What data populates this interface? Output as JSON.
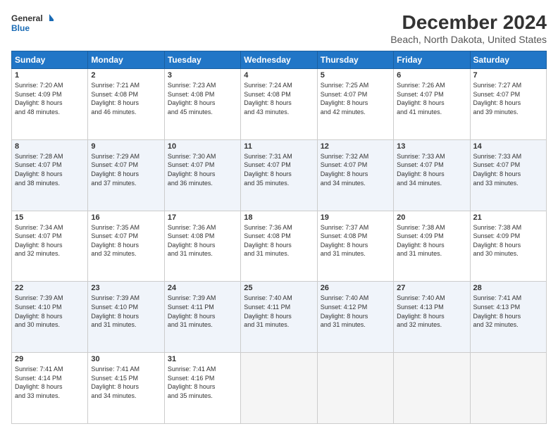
{
  "header": {
    "logo_line1": "General",
    "logo_line2": "Blue",
    "title": "December 2024",
    "subtitle": "Beach, North Dakota, United States"
  },
  "columns": [
    "Sunday",
    "Monday",
    "Tuesday",
    "Wednesday",
    "Thursday",
    "Friday",
    "Saturday"
  ],
  "rows": [
    [
      {
        "date": "1",
        "lines": [
          "Sunrise: 7:20 AM",
          "Sunset: 4:09 PM",
          "Daylight: 8 hours",
          "and 48 minutes."
        ]
      },
      {
        "date": "2",
        "lines": [
          "Sunrise: 7:21 AM",
          "Sunset: 4:08 PM",
          "Daylight: 8 hours",
          "and 46 minutes."
        ]
      },
      {
        "date": "3",
        "lines": [
          "Sunrise: 7:23 AM",
          "Sunset: 4:08 PM",
          "Daylight: 8 hours",
          "and 45 minutes."
        ]
      },
      {
        "date": "4",
        "lines": [
          "Sunrise: 7:24 AM",
          "Sunset: 4:08 PM",
          "Daylight: 8 hours",
          "and 43 minutes."
        ]
      },
      {
        "date": "5",
        "lines": [
          "Sunrise: 7:25 AM",
          "Sunset: 4:07 PM",
          "Daylight: 8 hours",
          "and 42 minutes."
        ]
      },
      {
        "date": "6",
        "lines": [
          "Sunrise: 7:26 AM",
          "Sunset: 4:07 PM",
          "Daylight: 8 hours",
          "and 41 minutes."
        ]
      },
      {
        "date": "7",
        "lines": [
          "Sunrise: 7:27 AM",
          "Sunset: 4:07 PM",
          "Daylight: 8 hours",
          "and 39 minutes."
        ]
      }
    ],
    [
      {
        "date": "8",
        "lines": [
          "Sunrise: 7:28 AM",
          "Sunset: 4:07 PM",
          "Daylight: 8 hours",
          "and 38 minutes."
        ]
      },
      {
        "date": "9",
        "lines": [
          "Sunrise: 7:29 AM",
          "Sunset: 4:07 PM",
          "Daylight: 8 hours",
          "and 37 minutes."
        ]
      },
      {
        "date": "10",
        "lines": [
          "Sunrise: 7:30 AM",
          "Sunset: 4:07 PM",
          "Daylight: 8 hours",
          "and 36 minutes."
        ]
      },
      {
        "date": "11",
        "lines": [
          "Sunrise: 7:31 AM",
          "Sunset: 4:07 PM",
          "Daylight: 8 hours",
          "and 35 minutes."
        ]
      },
      {
        "date": "12",
        "lines": [
          "Sunrise: 7:32 AM",
          "Sunset: 4:07 PM",
          "Daylight: 8 hours",
          "and 34 minutes."
        ]
      },
      {
        "date": "13",
        "lines": [
          "Sunrise: 7:33 AM",
          "Sunset: 4:07 PM",
          "Daylight: 8 hours",
          "and 34 minutes."
        ]
      },
      {
        "date": "14",
        "lines": [
          "Sunrise: 7:33 AM",
          "Sunset: 4:07 PM",
          "Daylight: 8 hours",
          "and 33 minutes."
        ]
      }
    ],
    [
      {
        "date": "15",
        "lines": [
          "Sunrise: 7:34 AM",
          "Sunset: 4:07 PM",
          "Daylight: 8 hours",
          "and 32 minutes."
        ]
      },
      {
        "date": "16",
        "lines": [
          "Sunrise: 7:35 AM",
          "Sunset: 4:07 PM",
          "Daylight: 8 hours",
          "and 32 minutes."
        ]
      },
      {
        "date": "17",
        "lines": [
          "Sunrise: 7:36 AM",
          "Sunset: 4:08 PM",
          "Daylight: 8 hours",
          "and 31 minutes."
        ]
      },
      {
        "date": "18",
        "lines": [
          "Sunrise: 7:36 AM",
          "Sunset: 4:08 PM",
          "Daylight: 8 hours",
          "and 31 minutes."
        ]
      },
      {
        "date": "19",
        "lines": [
          "Sunrise: 7:37 AM",
          "Sunset: 4:08 PM",
          "Daylight: 8 hours",
          "and 31 minutes."
        ]
      },
      {
        "date": "20",
        "lines": [
          "Sunrise: 7:38 AM",
          "Sunset: 4:09 PM",
          "Daylight: 8 hours",
          "and 31 minutes."
        ]
      },
      {
        "date": "21",
        "lines": [
          "Sunrise: 7:38 AM",
          "Sunset: 4:09 PM",
          "Daylight: 8 hours",
          "and 30 minutes."
        ]
      }
    ],
    [
      {
        "date": "22",
        "lines": [
          "Sunrise: 7:39 AM",
          "Sunset: 4:10 PM",
          "Daylight: 8 hours",
          "and 30 minutes."
        ]
      },
      {
        "date": "23",
        "lines": [
          "Sunrise: 7:39 AM",
          "Sunset: 4:10 PM",
          "Daylight: 8 hours",
          "and 31 minutes."
        ]
      },
      {
        "date": "24",
        "lines": [
          "Sunrise: 7:39 AM",
          "Sunset: 4:11 PM",
          "Daylight: 8 hours",
          "and 31 minutes."
        ]
      },
      {
        "date": "25",
        "lines": [
          "Sunrise: 7:40 AM",
          "Sunset: 4:11 PM",
          "Daylight: 8 hours",
          "and 31 minutes."
        ]
      },
      {
        "date": "26",
        "lines": [
          "Sunrise: 7:40 AM",
          "Sunset: 4:12 PM",
          "Daylight: 8 hours",
          "and 31 minutes."
        ]
      },
      {
        "date": "27",
        "lines": [
          "Sunrise: 7:40 AM",
          "Sunset: 4:13 PM",
          "Daylight: 8 hours",
          "and 32 minutes."
        ]
      },
      {
        "date": "28",
        "lines": [
          "Sunrise: 7:41 AM",
          "Sunset: 4:13 PM",
          "Daylight: 8 hours",
          "and 32 minutes."
        ]
      }
    ],
    [
      {
        "date": "29",
        "lines": [
          "Sunrise: 7:41 AM",
          "Sunset: 4:14 PM",
          "Daylight: 8 hours",
          "and 33 minutes."
        ]
      },
      {
        "date": "30",
        "lines": [
          "Sunrise: 7:41 AM",
          "Sunset: 4:15 PM",
          "Daylight: 8 hours",
          "and 34 minutes."
        ]
      },
      {
        "date": "31",
        "lines": [
          "Sunrise: 7:41 AM",
          "Sunset: 4:16 PM",
          "Daylight: 8 hours",
          "and 35 minutes."
        ]
      },
      {
        "date": "",
        "lines": []
      },
      {
        "date": "",
        "lines": []
      },
      {
        "date": "",
        "lines": []
      },
      {
        "date": "",
        "lines": []
      }
    ]
  ]
}
